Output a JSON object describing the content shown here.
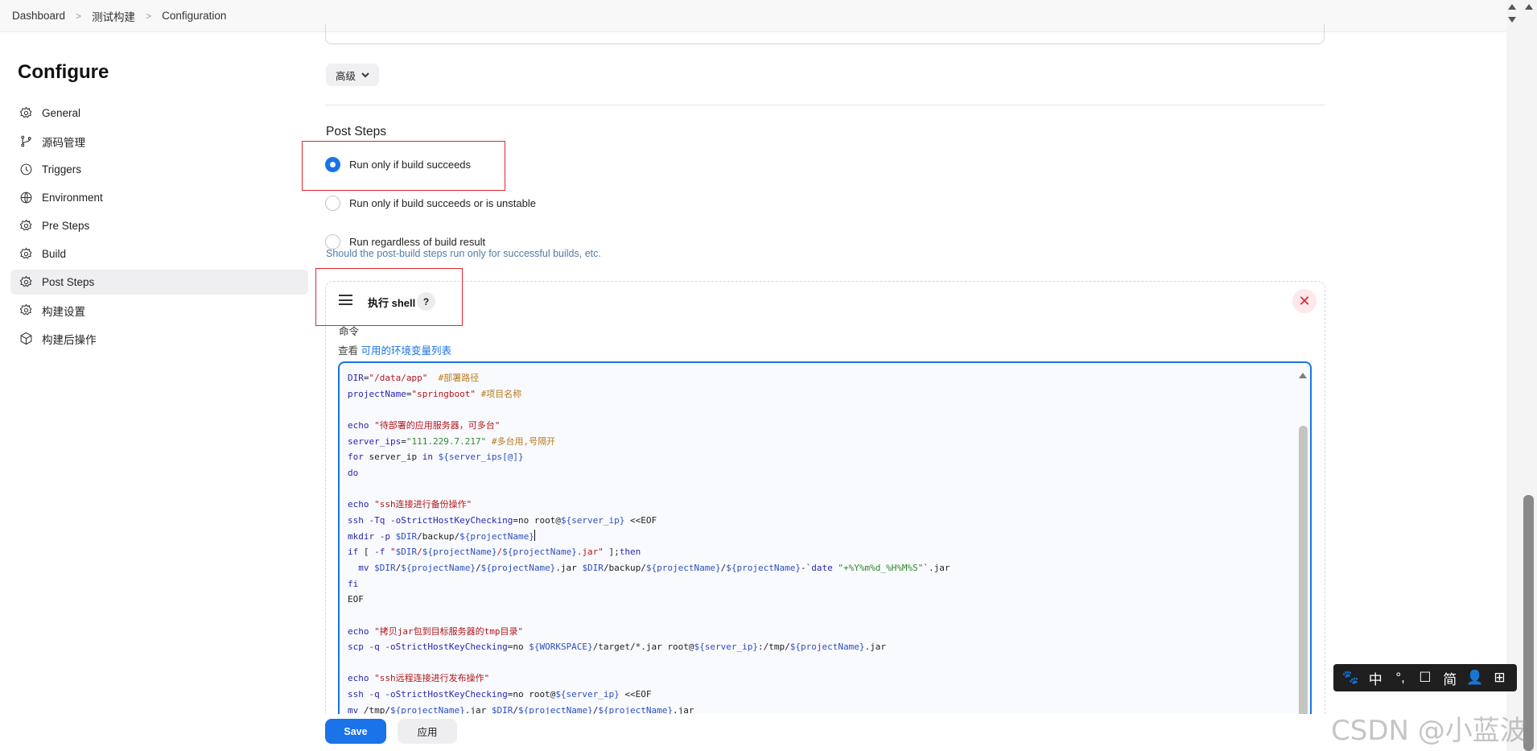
{
  "breadcrumb": [
    "Dashboard",
    "测试构建",
    "Configuration"
  ],
  "sidebar": {
    "title": "Configure",
    "items": [
      {
        "label": "General",
        "icon": "gear-icon"
      },
      {
        "label": "源码管理",
        "icon": "git-branch-icon"
      },
      {
        "label": "Triggers",
        "icon": "clock-icon"
      },
      {
        "label": "Environment",
        "icon": "globe-icon"
      },
      {
        "label": "Pre Steps",
        "icon": "gear-icon"
      },
      {
        "label": "Build",
        "icon": "gear-icon"
      },
      {
        "label": "Post Steps",
        "icon": "gear-icon",
        "active": true
      },
      {
        "label": "构建设置",
        "icon": "gear-icon"
      },
      {
        "label": "构建后操作",
        "icon": "cube-icon"
      }
    ]
  },
  "main": {
    "advanced_label": "高级",
    "section_title": "Post Steps",
    "radios": [
      {
        "label": "Run only if build succeeds",
        "checked": true
      },
      {
        "label": "Run only if build succeeds or is unstable",
        "checked": false
      },
      {
        "label": "Run regardless of build result",
        "checked": false
      }
    ],
    "radio_help": "Should the post-build steps run only for successful builds, etc.",
    "step": {
      "title": "执行 shell",
      "help": "?",
      "close": "✕",
      "command_label": "命令",
      "env_prefix": "查看",
      "env_link": "可用的环境变量列表"
    },
    "code_lines": [
      "DIR=\"/data/app\"  #部署路径",
      "projectName=\"springboot\" #项目名称",
      "",
      "echo \"待部署的应用服务器，可多台\"",
      "server_ips=\"111.229.7.217\" #多台用,号隔开",
      "for server_ip in ${server_ips[@]}",
      "do",
      "",
      "echo \"ssh连接进行备份操作\"",
      "ssh -Tq -oStrictHostKeyChecking=no root@${server_ip} <<EOF",
      "mkdir -p $DIR/backup/${projectName}",
      "if [ -f \"$DIR/${projectName}/${projectName}.jar\" ];then",
      "  mv $DIR/${projectName}/${projectName}.jar $DIR/backup/${projectName}/${projectName}-`date \"+%Y%m%d_%H%M%S\"`.jar",
      "fi",
      "EOF",
      "",
      "echo \"拷贝jar包到目标服务器的tmp目录\"",
      "scp -q -oStrictHostKeyChecking=no ${WORKSPACE}/target/*.jar root@${server_ip}:/tmp/${projectName}.jar",
      "",
      "echo \"ssh远程连接进行发布操作\"",
      "ssh -q -oStrictHostKeyChecking=no root@${server_ip} <<EOF",
      "mv /tmp/${projectName}.jar $DIR/${projectName}/${projectName}.jar"
    ]
  },
  "footer": {
    "save_label": "Save",
    "apply_label": "应用"
  },
  "ime": [
    "🐾",
    "中",
    "°,",
    "☐",
    "简",
    "👤",
    "⊞"
  ],
  "watermark": "CSDN @小蓝波",
  "colors": {
    "accent": "#1a73e8",
    "highlight_box": "#e0262b"
  }
}
